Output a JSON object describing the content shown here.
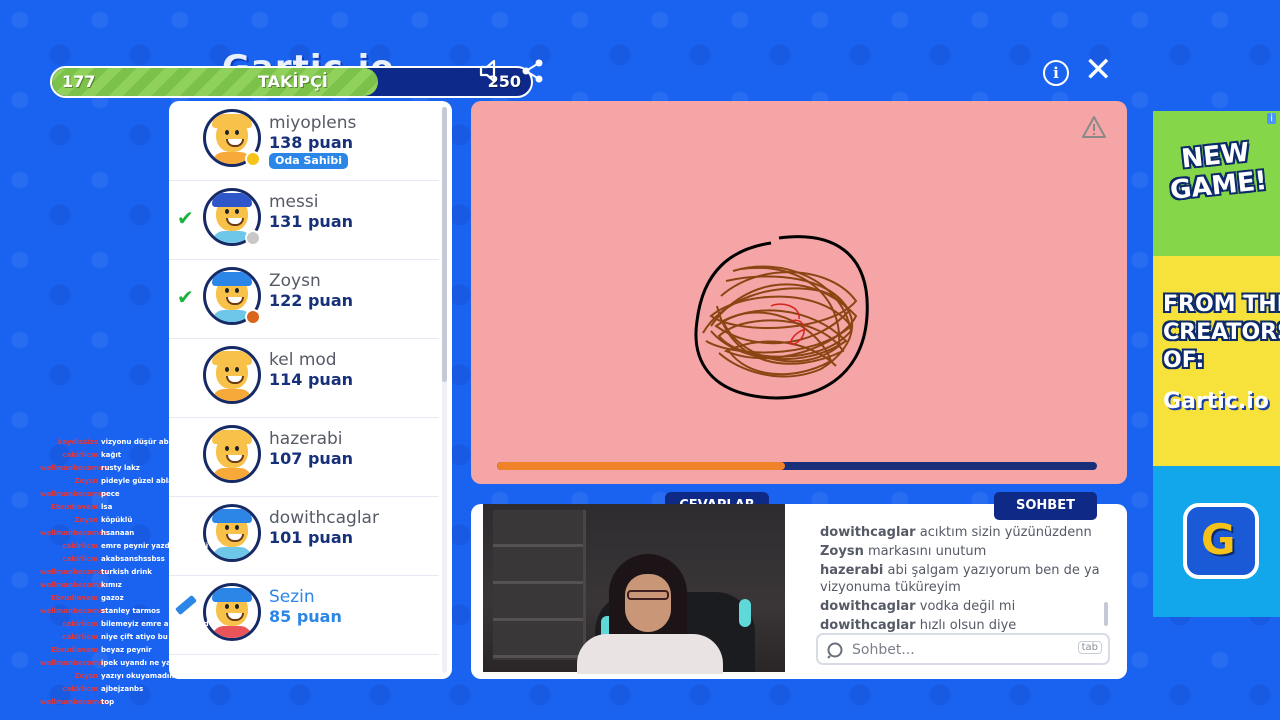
{
  "header": {
    "logo": "Gartic.io",
    "follow": {
      "current": "177",
      "label": "TAKİPÇİ",
      "goal": "250",
      "progress": 0.68
    }
  },
  "players": [
    {
      "name": "miyoplens",
      "score": "138 puan",
      "badge": "Oda Sahibi",
      "status_color": "#f5c518",
      "mark": "",
      "body": "#f7a93a",
      "hair": "#f7c14a"
    },
    {
      "name": "messi",
      "score": "131 puan",
      "badge": "",
      "status_color": "#c8c8c8",
      "mark": "check",
      "body": "#6ec7e8",
      "hair": "#2f57c9"
    },
    {
      "name": "Zoysn",
      "score": "122 puan",
      "badge": "",
      "status_color": "#d9661b",
      "mark": "check",
      "body": "#6ec7e8",
      "hair": "#2b86e8"
    },
    {
      "name": "kel mod",
      "score": "114 puan",
      "badge": "",
      "status_color": "",
      "mark": "",
      "body": "#f7a93a",
      "hair": "#f7c14a"
    },
    {
      "name": "hazerabi",
      "score": "107 puan",
      "badge": "",
      "status_color": "",
      "mark": "",
      "body": "#f7a93a",
      "hair": "#f7c14a"
    },
    {
      "name": "dowithcaglar",
      "score": "101 puan",
      "badge": "",
      "status_color": "",
      "mark": "",
      "body": "#6ec7e8",
      "hair": "#2b86e8"
    },
    {
      "name": "Sezin",
      "score": "85 puan",
      "badge": "",
      "status_color": "",
      "mark": "pencil",
      "body": "#e8545a",
      "hair": "#2b86e8"
    }
  ],
  "canvas": {
    "timer_progress": 0.48
  },
  "tabs": {
    "answers": "CEVAPLAR",
    "chat": "SOHBET"
  },
  "chat": {
    "messages": [
      {
        "user": "dowithcaglar",
        "text": "acıktım sizin yüzünüzdenn"
      },
      {
        "user": "Zoysn",
        "text": "markasını unutum"
      },
      {
        "user": "hazerabi",
        "text": "abi şalgam yazıyorum ben de ya vizyonuma tüküreyim"
      },
      {
        "user": "dowithcaglar",
        "text": "vodka değil mi"
      },
      {
        "user": "dowithcaglar",
        "text": "hızlı olsun diye"
      }
    ],
    "input_placeholder": "Sohbet...",
    "tab_hint": "tab"
  },
  "ad": {
    "headline": "NEW GAME!",
    "subline": "FROM THE CREATORS OF:",
    "brand": "Gartic.io",
    "icon_letter": "G",
    "info": "i"
  },
  "overlay_chat": [
    {
      "user": "kaydissizs",
      "text": "vizyonu düşür abla"
    },
    {
      "user": "cakirlicm",
      "text": "kağıt"
    },
    {
      "user": "wellmanbecomes",
      "text": "rusty lakz"
    },
    {
      "user": "Zoysn",
      "text": "pideyle güzel abla"
    },
    {
      "user": "wellmanbecomes",
      "text": "pece"
    },
    {
      "user": "Ebrudiavam",
      "text": "lsa"
    },
    {
      "user": "Zoysn",
      "text": "köpüklü"
    },
    {
      "user": "wellmanbecomes",
      "text": "hsanaan"
    },
    {
      "user": "cakirlicm",
      "text": "emre peynir yazdi diye aldi"
    },
    {
      "user": "cakirlicm",
      "text": "akabsanshssbss"
    },
    {
      "user": "wellmanbecomes",
      "text": "turkish drink"
    },
    {
      "user": "wellmanbecomes",
      "text": "kımız"
    },
    {
      "user": "Ebrudiavam",
      "text": "gazoz"
    },
    {
      "user": "wellmanbecomes",
      "text": "stanley tarmos"
    },
    {
      "user": "cakirlicm",
      "text": "bilemeyiz emre akbejsbsbd"
    },
    {
      "user": "cakirlicm",
      "text": "niye çift atiyo bu gun la"
    },
    {
      "user": "Ebrudiavam",
      "text": "beyaz peynir"
    },
    {
      "user": "wellmanbecomes",
      "text": "ipek uyandı ne yapayım"
    },
    {
      "user": "Zoysn",
      "text": "yazıyı okuyamadım ki"
    },
    {
      "user": "cakirlicm",
      "text": "ajbejzanbs"
    },
    {
      "user": "wellmanbecomes",
      "text": "top"
    }
  ]
}
